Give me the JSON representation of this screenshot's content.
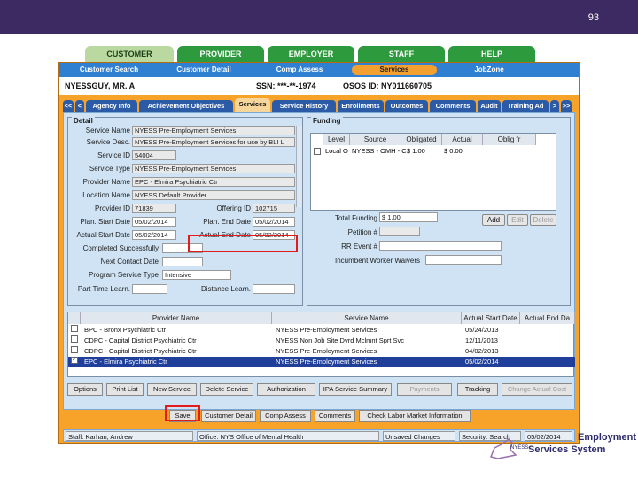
{
  "slide": {
    "page_number": "93"
  },
  "main_tabs": [
    "CUSTOMER",
    "PROVIDER",
    "EMPLOYER",
    "STAFF",
    "HELP"
  ],
  "sub_nav": [
    "Customer Search",
    "Customer Detail",
    "Comp Assess",
    "Services",
    "JobZone"
  ],
  "customer_bar": {
    "name": "NYESSGUY, MR. A",
    "ssn": "SSN: ***-**-1974",
    "osos": "OSOS ID: NY011660705"
  },
  "service_tabs": [
    "<<",
    "<",
    "Agency Info",
    "Achievement Objectives",
    "Services",
    "Service History",
    "Enrollments",
    "Outcomes",
    "Comments",
    "Audit",
    "Training Ad",
    ">",
    ">>"
  ],
  "detail": {
    "title": "Detail",
    "service_name_label": "Service Name",
    "service_name": "NYESS Pre-Employment Services",
    "service_desc_label": "Service Desc.",
    "service_desc": "NYESS Pre-Employment Services for use by BLI L",
    "service_id_label": "Service ID",
    "service_id": "54004",
    "service_type_label": "Service Type",
    "service_type": "NYESS Pre-Employment Services",
    "provider_name_label": "Provider Name",
    "provider_name": "EPC - Elmira Psychiatric Ctr",
    "location_name_label": "Location Name",
    "location_name": "NYESS Default Provider",
    "provider_id_label": "Provider ID",
    "provider_id": "71839",
    "offering_id_label": "Offering ID",
    "offering_id": "102715",
    "plan_start_label": "Plan. Start Date",
    "plan_start": "05/02/2014",
    "plan_end_label": "Plan. End Date",
    "plan_end": "05/02/2014",
    "actual_start_label": "Actual Start Date",
    "actual_start": "05/02/2014",
    "actual_end_label": "Actual End Date",
    "actual_end": "05/02/2014",
    "completed_label": "Completed Successfully",
    "next_contact_label": "Next Contact Date",
    "intensity_label": "Program Service Type",
    "intensity_value": "Intensive",
    "part_time_label": "Part Time Learn.",
    "distance_label": "Distance Learn."
  },
  "funding": {
    "title": "Funding",
    "columns": [
      "Level",
      "Source",
      "Obligated",
      "Actual",
      "Oblig fr"
    ],
    "row": {
      "level": "Local O",
      "source": "NYESS - OMH - C",
      "obligated": "$ 1.00",
      "actual": "$ 0.00"
    },
    "buttons": [
      "Add",
      "Edit",
      "Delete"
    ],
    "total_label": "Total Funding",
    "total_value": "$ 1.00",
    "petition_label": "Petition #",
    "rr_event_label": "RR Event #",
    "incumbent_label": "Incumbent Worker Waivers"
  },
  "list": {
    "columns": [
      "Provider Name",
      "Service Name",
      "Actual Start Date",
      "Actual End Da"
    ],
    "rows": [
      {
        "provider": "BPC - Bronx Psychiatric Ctr",
        "service": "NYESS Pre-Employment Services",
        "start": "05/24/2013",
        "checked": ""
      },
      {
        "provider": "CDPC - Capital District Psychiatric Ctr",
        "service": "NYESS Non Job Site Dvrd Mclmnt Sprt Svc",
        "start": "12/11/2013",
        "checked": ""
      },
      {
        "provider": "CDPC - Capital District Psychiatric Ctr",
        "service": "NYESS Pre-Employment Services",
        "start": "04/02/2013",
        "checked": ""
      },
      {
        "provider": "EPC - Elmira Psychiatric Ctr",
        "service": "NYESS Pre-Employment Services",
        "start": "05/02/2014",
        "checked": "✓"
      }
    ]
  },
  "action_buttons": [
    "Options",
    "Print List",
    "New Service",
    "Delete Service",
    "Authorization",
    "IPA Service Summary",
    "Payments",
    "Tracking",
    "Change Actual Cost"
  ],
  "bottom_buttons": [
    "Save",
    "Customer Detail",
    "Comp Assess",
    "Comments",
    "Check Labor Market Information"
  ],
  "status": {
    "staff": "Staff: Karhan, Andrew",
    "office": "Office: NYS Office of Mental Health",
    "unsaved": "Unsaved Changes",
    "security": "Security: Search",
    "date": "05/02/2014"
  },
  "logo": {
    "line1": "Employment",
    "line2": "Services System",
    "small": "NYESS"
  }
}
